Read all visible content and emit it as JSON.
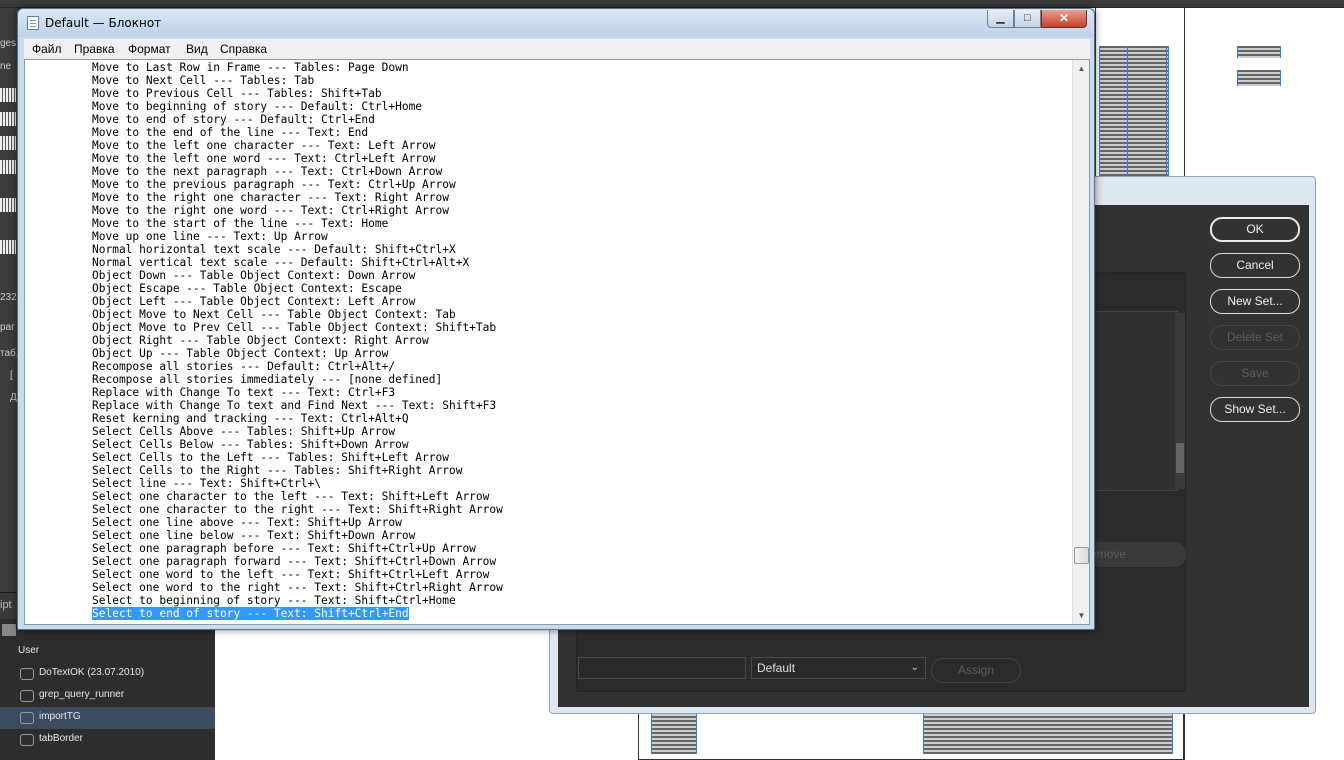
{
  "notepad": {
    "title": "Default — Блокнот",
    "controls": {
      "minimize": "▁",
      "maximize": "□",
      "close": "✕"
    },
    "menu": [
      "Файл",
      "Правка",
      "Формат",
      "Вид",
      "Справка"
    ],
    "lines": [
      "Move to Last Row in Frame --- Tables: Page Down",
      "Move to Next Cell --- Tables: Tab",
      "Move to Previous Cell --- Tables: Shift+Tab",
      "Move to beginning of story --- Default: Ctrl+Home",
      "Move to end of story --- Default: Ctrl+End",
      "Move to the end of the line --- Text: End",
      "Move to the left one character --- Text: Left Arrow",
      "Move to the left one word --- Text: Ctrl+Left Arrow",
      "Move to the next paragraph --- Text: Ctrl+Down Arrow",
      "Move to the previous paragraph --- Text: Ctrl+Up Arrow",
      "Move to the right one character --- Text: Right Arrow",
      "Move to the right one word --- Text: Ctrl+Right Arrow",
      "Move to the start of the line --- Text: Home",
      "Move up one line --- Text: Up Arrow",
      "Normal horizontal text scale --- Default: Shift+Ctrl+X",
      "Normal vertical text scale --- Default: Shift+Ctrl+Alt+X",
      "Object Down --- Table Object Context: Down Arrow",
      "Object Escape --- Table Object Context: Escape",
      "Object Left --- Table Object Context: Left Arrow",
      "Object Move to Next Cell --- Table Object Context: Tab",
      "Object Move to Prev Cell --- Table Object Context: Shift+Tab",
      "Object Right --- Table Object Context: Right Arrow",
      "Object Up --- Table Object Context: Up Arrow",
      "Recompose all stories --- Default: Ctrl+Alt+/",
      "Recompose all stories immediately --- [none defined]",
      "Replace with Change To text --- Text: Ctrl+F3",
      "Replace with Change To text and Find Next --- Text: Shift+F3",
      "Reset kerning and tracking --- Text: Ctrl+Alt+Q",
      "Select Cells Above --- Tables: Shift+Up Arrow",
      "Select Cells Below --- Tables: Shift+Down Arrow",
      "Select Cells to the Left --- Tables: Shift+Left Arrow",
      "Select Cells to the Right --- Tables: Shift+Right Arrow",
      "Select line --- Text: Shift+Ctrl+\\",
      "Select one character to the left --- Text: Shift+Left Arrow",
      "Select one character to the right --- Text: Shift+Right Arrow",
      "Select one line above --- Text: Shift+Up Arrow",
      "Select one line below --- Text: Shift+Down Arrow",
      "Select one paragraph before --- Text: Shift+Ctrl+Up Arrow",
      "Select one paragraph forward --- Text: Shift+Ctrl+Down Arrow",
      "Select one word to the left --- Text: Shift+Ctrl+Left Arrow",
      "Select one word to the right --- Text: Shift+Ctrl+Right Arrow",
      "Select to beginning of story --- Text: Shift+Ctrl+Home",
      "Select to end of story --- Text: Shift+Ctrl+End"
    ],
    "selected_line_index": 42
  },
  "shortcuts_dialog": {
    "buttons": {
      "ok": "OK",
      "cancel": "Cancel",
      "new_set": "New Set...",
      "delete_set": "Delete Set",
      "save": "Save",
      "show_set": "Show Set..."
    },
    "remove_label": "emove",
    "context_select": "Default",
    "assign_label": "Assign"
  },
  "scripts_panel": {
    "header": "ipt",
    "folder": "User",
    "items": [
      {
        "label": "DoTextOK (23.07.2010)",
        "selected": false
      },
      {
        "label": "grep_query_runner",
        "selected": false
      },
      {
        "label": "importTG",
        "selected": true
      },
      {
        "label": "tabBorder",
        "selected": false
      }
    ]
  },
  "left_panel_tags": [
    "ges",
    "ne",
    "232",
    "раг",
    "таб.",
    "[",
    "Д"
  ],
  "colors": {
    "selection": "#3399ff",
    "titlebar": "#c9dcee",
    "close_button": "#c4412a",
    "dark_ui": "#323232"
  }
}
